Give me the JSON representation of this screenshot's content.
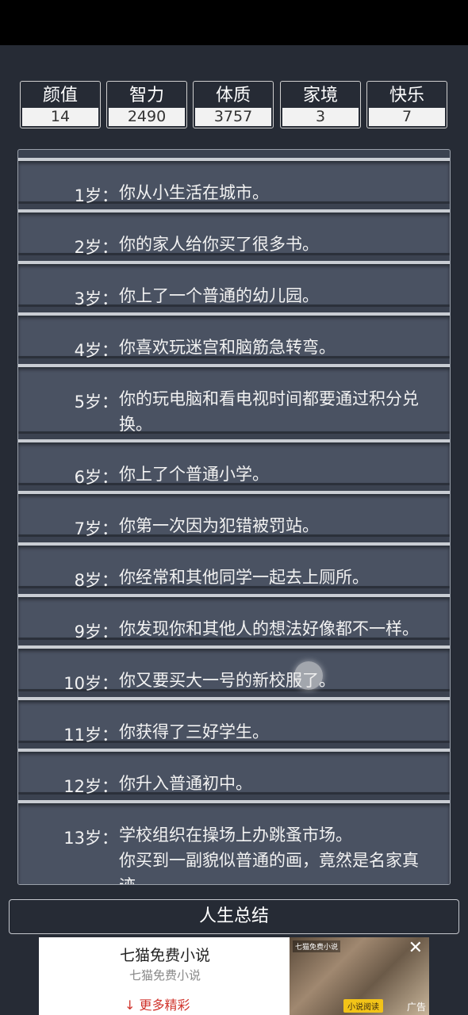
{
  "stats": [
    {
      "label": "颜值",
      "value": "14"
    },
    {
      "label": "智力",
      "value": "2490"
    },
    {
      "label": "体质",
      "value": "3757"
    },
    {
      "label": "家境",
      "value": "3"
    },
    {
      "label": "快乐",
      "value": "7"
    }
  ],
  "log": [
    {
      "age": "1岁：",
      "text": "你从小生活在城市。"
    },
    {
      "age": "2岁：",
      "text": "你的家人给你买了很多书。"
    },
    {
      "age": "3岁：",
      "text": "你上了一个普通的幼儿园。"
    },
    {
      "age": "4岁：",
      "text": "你喜欢玩迷宫和脑筋急转弯。"
    },
    {
      "age": "5岁：",
      "text": "你的玩电脑和看电视时间都要通过积分兑换。"
    },
    {
      "age": "6岁：",
      "text": "你上了个普通小学。"
    },
    {
      "age": "7岁：",
      "text": "你第一次因为犯错被罚站。"
    },
    {
      "age": "8岁：",
      "text": "你经常和其他同学一起去上厕所。"
    },
    {
      "age": "9岁：",
      "text": "你发现你和其他人的想法好像都不一样。"
    },
    {
      "age": "10岁：",
      "text": "你又要买大一号的新校服了。"
    },
    {
      "age": "11岁：",
      "text": "你获得了三好学生。"
    },
    {
      "age": "12岁：",
      "text": "你升入普通初中。"
    },
    {
      "age": "13岁：",
      "text": "学校组织在操场上办跳蚤市场。\n你买到一副貌似普通的画，竟然是名家真迹。"
    }
  ],
  "summary_button": "人生总结",
  "ad": {
    "title": "七猫免费小说",
    "subtitle": "七猫免费小说",
    "more": "更多精彩",
    "image_badge": "七猫免费小说",
    "read_button": "小说阅读",
    "ad_label": "广告"
  }
}
